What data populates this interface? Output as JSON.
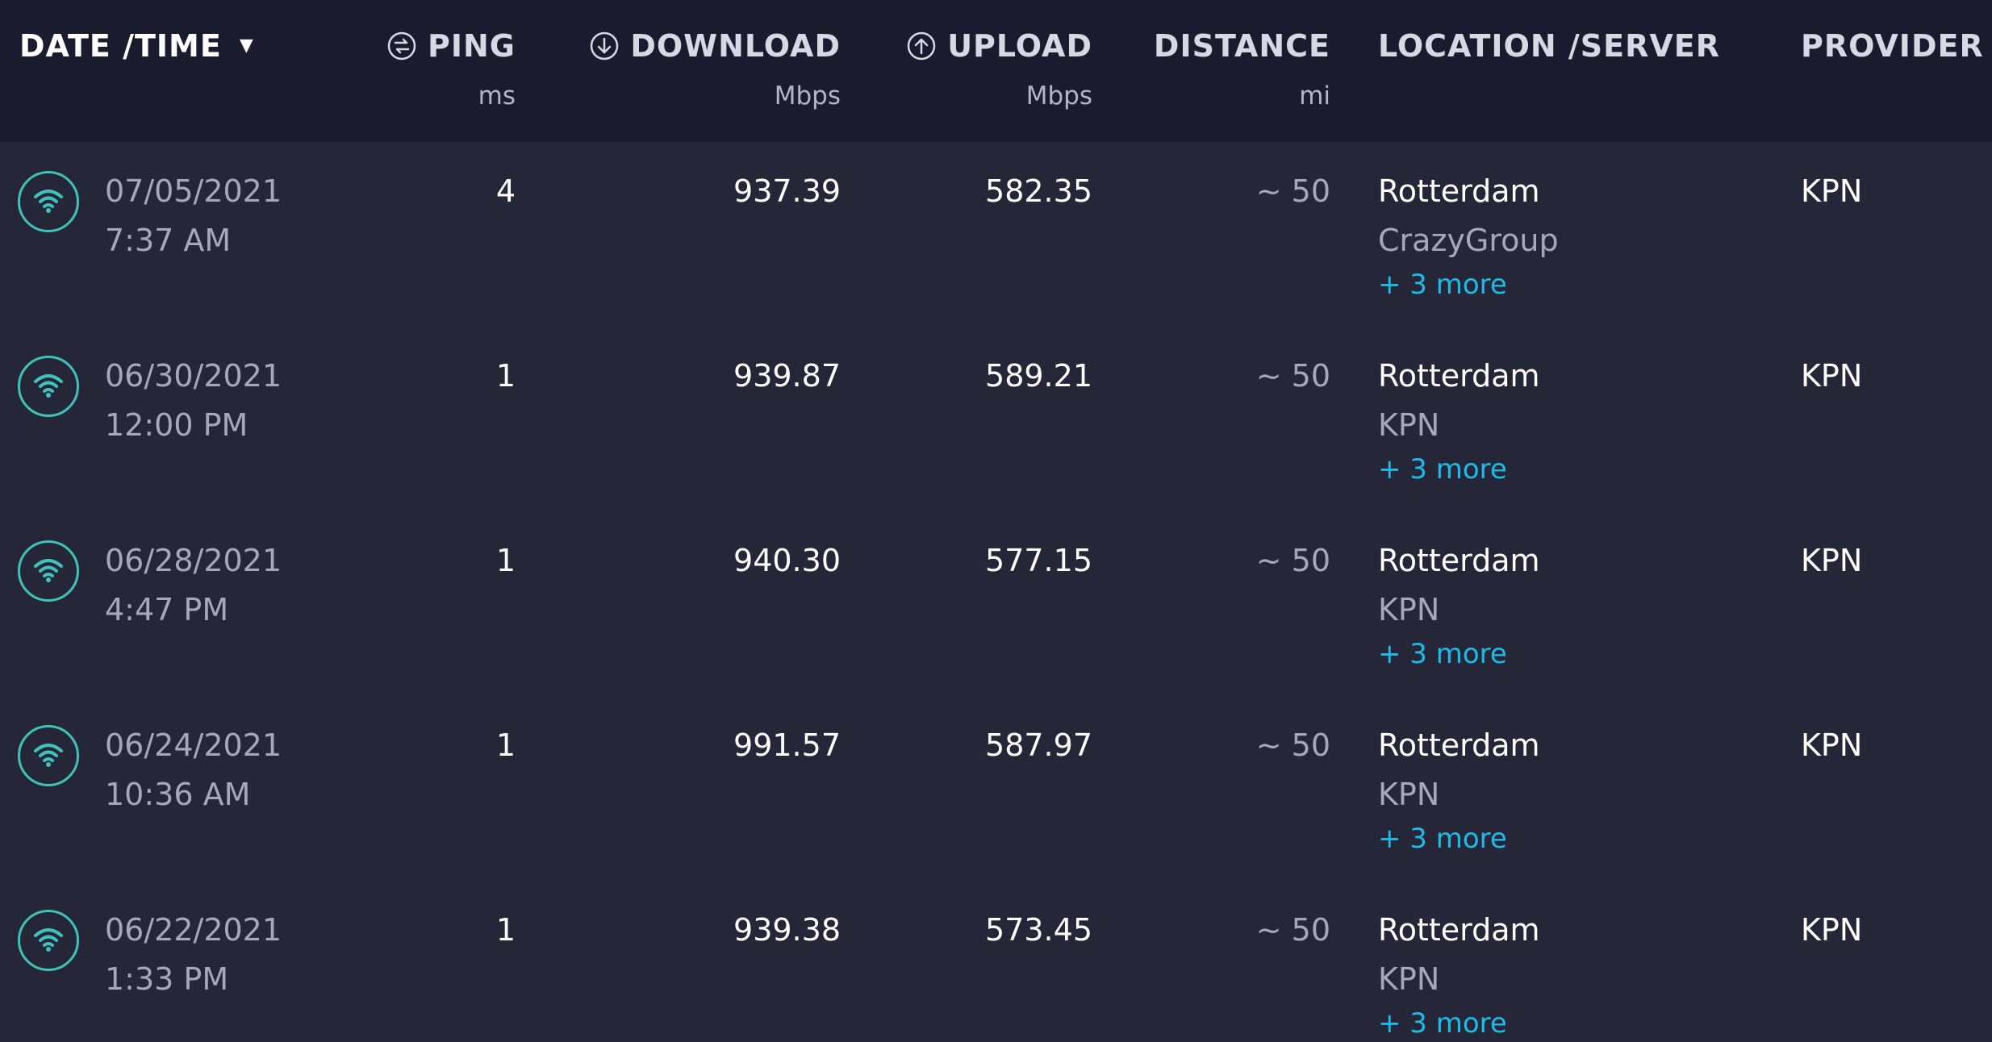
{
  "header": {
    "datetime_label": "DATE /TIME",
    "sort_indicator": "▼",
    "ping_label": "PING",
    "ping_unit": "ms",
    "download_label": "DOWNLOAD",
    "download_unit": "Mbps",
    "upload_label": "UPLOAD",
    "upload_unit": "Mbps",
    "distance_label": "DISTANCE",
    "distance_unit": "mi",
    "location_label": "LOCATION /SERVER",
    "provider_label": "PROVIDER"
  },
  "icons": {
    "ping": "ping-icon",
    "download": "download-icon",
    "upload": "upload-icon",
    "connection": "wifi-icon"
  },
  "colors": {
    "background": "#252638",
    "header_background": "#1a1b2e",
    "wifi_accent": "#3fc2ba",
    "link": "#1ebae8"
  },
  "rows": [
    {
      "date": "07/05/2021",
      "time": "7:37 AM",
      "ping": "4",
      "download": "937.39",
      "upload": "582.35",
      "distance": "~ 50",
      "location": "Rotterdam",
      "server": "CrazyGroup",
      "more": "+ 3 more",
      "provider": "KPN"
    },
    {
      "date": "06/30/2021",
      "time": "12:00 PM",
      "ping": "1",
      "download": "939.87",
      "upload": "589.21",
      "distance": "~ 50",
      "location": "Rotterdam",
      "server": "KPN",
      "more": "+ 3 more",
      "provider": "KPN"
    },
    {
      "date": "06/28/2021",
      "time": "4:47 PM",
      "ping": "1",
      "download": "940.30",
      "upload": "577.15",
      "distance": "~ 50",
      "location": "Rotterdam",
      "server": "KPN",
      "more": "+ 3 more",
      "provider": "KPN"
    },
    {
      "date": "06/24/2021",
      "time": "10:36 AM",
      "ping": "1",
      "download": "991.57",
      "upload": "587.97",
      "distance": "~ 50",
      "location": "Rotterdam",
      "server": "KPN",
      "more": "+ 3 more",
      "provider": "KPN"
    },
    {
      "date": "06/22/2021",
      "time": "1:33 PM",
      "ping": "1",
      "download": "939.38",
      "upload": "573.45",
      "distance": "~ 50",
      "location": "Rotterdam",
      "server": "KPN",
      "more": "+ 3 more",
      "provider": "KPN"
    }
  ]
}
